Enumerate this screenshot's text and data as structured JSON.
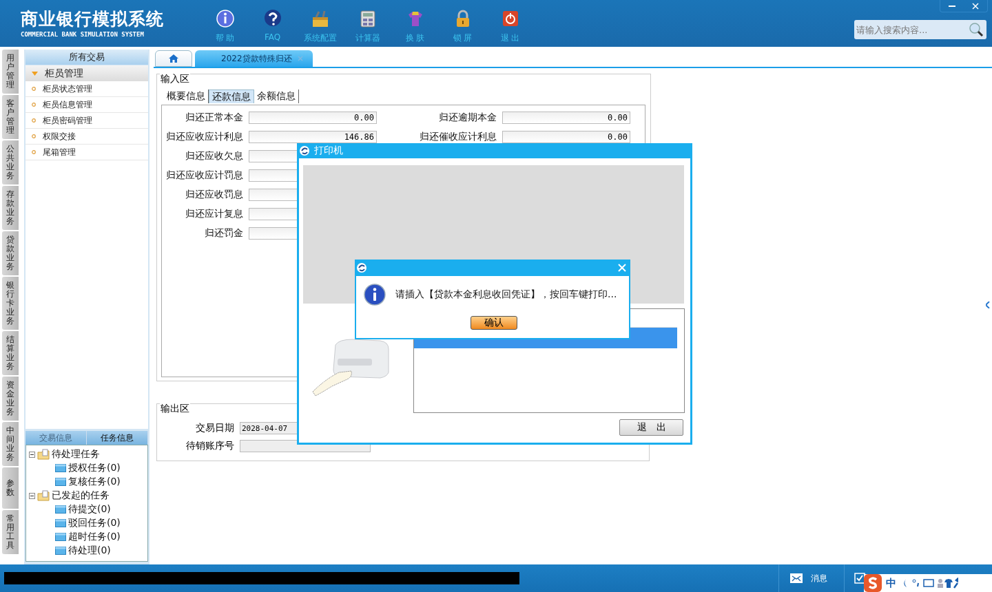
{
  "app": {
    "title": "商业银行模拟系统",
    "subtitle": "COMMERCIAL BANK SIMULATION SYSTEM"
  },
  "toolbar": [
    {
      "label": "帮 助",
      "kind": "help"
    },
    {
      "label": "FAQ",
      "kind": "faq"
    },
    {
      "label": "系统配置",
      "kind": "config"
    },
    {
      "label": "计算器",
      "kind": "calc"
    },
    {
      "label": "换 肤",
      "kind": "skin"
    },
    {
      "label": "锁 屏",
      "kind": "lock"
    },
    {
      "label": "退 出",
      "kind": "exit"
    }
  ],
  "search": {
    "placeholder": "请输入搜索内容..."
  },
  "side_tabs": [
    "用户管理",
    "客户管理",
    "公共业务",
    "存款业务",
    "贷款业务",
    "银行卡业务",
    "结算业务",
    "资金业务",
    "中间业务",
    "参数",
    "常用工具"
  ],
  "sidebar": {
    "header": "所有交易",
    "group": {
      "label": "柜员管理",
      "expanded": true
    },
    "items": [
      "柜员状态管理",
      "柜员信息管理",
      "柜员密码管理",
      "权限交接",
      "尾箱管理"
    ]
  },
  "task_panel": {
    "tabs": [
      {
        "label": "交易信息",
        "selected": false
      },
      {
        "label": "任务信息",
        "selected": true
      }
    ],
    "tree": [
      {
        "label": "待处理任务",
        "expanded": true,
        "children": [
          {
            "label": "授权任务(0)"
          },
          {
            "label": "复核任务(0)"
          }
        ]
      },
      {
        "label": "已发起的任务",
        "expanded": true,
        "children": [
          {
            "label": "待提交(0)"
          },
          {
            "label": "驳回任务(0)"
          },
          {
            "label": "超时任务(0)"
          },
          {
            "label": "待处理(0)"
          }
        ]
      }
    ]
  },
  "doc_tabs": [
    {
      "kind": "home"
    },
    {
      "kind": "page",
      "label": "2022贷款特殊归还",
      "selected": true
    }
  ],
  "input_area": {
    "title": "输入区",
    "tabs": [
      {
        "label": "概要信息",
        "selected": false
      },
      {
        "label": "还款信息",
        "selected": true
      },
      {
        "label": "余额信息",
        "selected": false
      }
    ],
    "left_fields": [
      {
        "label": "归还正常本金",
        "value": "0.00"
      },
      {
        "label": "归还应收应计利息",
        "value": "146.86"
      },
      {
        "label": "归还应收欠息"
      },
      {
        "label": "归还应收应计罚息"
      },
      {
        "label": "归还应收罚息"
      },
      {
        "label": "归还应计复息"
      },
      {
        "label": "归还罚金"
      }
    ],
    "right_fields": [
      {
        "label": "归还逾期本金",
        "value": "0.00"
      },
      {
        "label": "归还催收应计利息",
        "value": "0.00"
      }
    ]
  },
  "output_area": {
    "title": "输出区",
    "fields": [
      {
        "label": "交易日期",
        "value": "2028-04-07"
      },
      {
        "label": "待销账序号"
      }
    ]
  },
  "printer_dialog": {
    "title": "打印机",
    "exit_button": "退　出"
  },
  "alert": {
    "message": "请插入【贷款本金利息收回凭证】，按回车键打印...",
    "ok_button": "确认"
  },
  "status_bar": {
    "items": [
      {
        "label": "消息"
      }
    ],
    "ime": "中"
  }
}
